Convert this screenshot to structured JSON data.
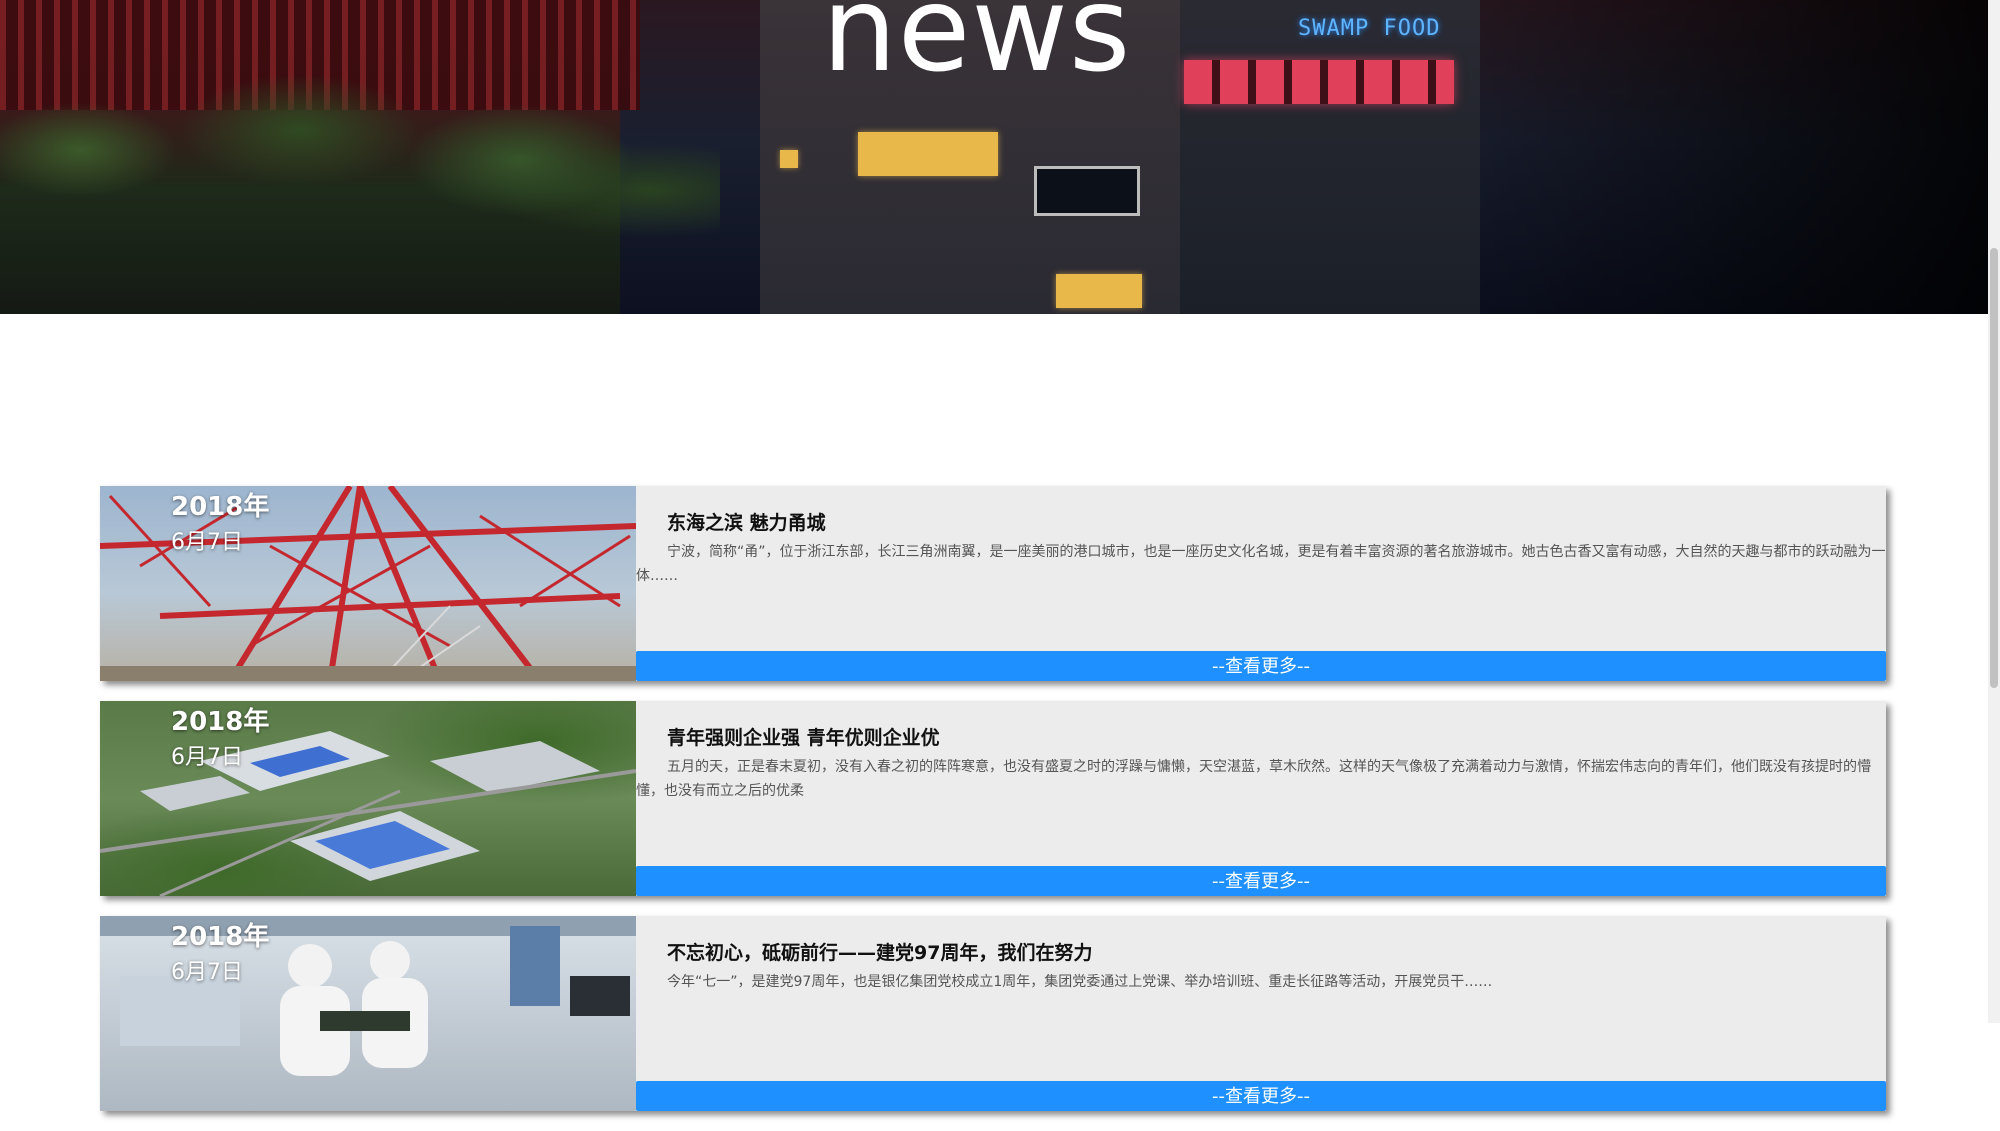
{
  "hero": {
    "title": "news",
    "neon_sign": "SWAMP FOOD"
  },
  "news": [
    {
      "year": "2018年",
      "day": "6月7日",
      "title": "东海之滨 魅力甬城",
      "summary": "宁波，简称“甬”，位于浙江东部，长江三角洲南翼，是一座美丽的港口城市，也是一座历史文化名城，更是有着丰富资源的著名旅游城市。她古色古香又富有动感，大自然的天趣与都市的跃动融为一体……",
      "more_label": "--查看更多--",
      "image": "transmission-tower"
    },
    {
      "year": "2018年",
      "day": "6月7日",
      "title": "青年强则企业强 青年优则企业优",
      "summary": "五月的天，正是春末夏初，没有入春之初的阵阵寒意，也没有盛夏之时的浮躁与慵懒，天空湛蓝，草木欣然。这样的天气像极了充满着动力与激情，怀揣宏伟志向的青年们，他们既没有孩提时的懵懂，也没有而立之后的优柔",
      "more_label": "--查看更多--",
      "image": "factory-aerial"
    },
    {
      "year": "2018年",
      "day": "6月7日",
      "title": "不忘初心，砥砺前行——建党97周年，我们在努力",
      "summary": "今年“七一”，是建党97周年，也是银亿集团党校成立1周年，集团党委通过上党课、举办培训班、重走长征路等活动，开展党员干……",
      "more_label": "--查看更多--",
      "image": "lab-workers"
    }
  ],
  "colors": {
    "accent": "#1e90ff",
    "card_bg": "#ececec",
    "title_text": "#111111",
    "body_text": "#555555"
  }
}
